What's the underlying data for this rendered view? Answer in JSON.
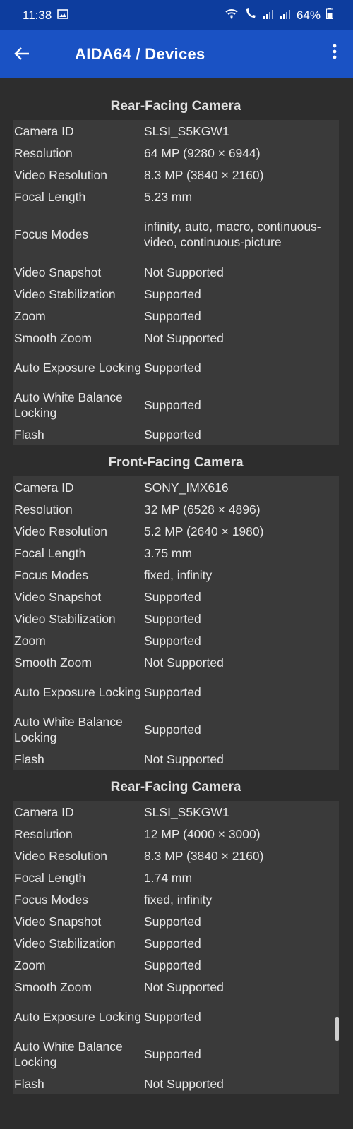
{
  "status": {
    "time": "11:38",
    "battery": "64%"
  },
  "appbar": {
    "title": "AIDA64  /  Devices"
  },
  "sections": [
    {
      "title": "Rear-Facing Camera",
      "rows": [
        {
          "label": "Camera ID",
          "value": "SLSI_S5KGW1"
        },
        {
          "label": "Resolution",
          "value": "64 MP (9280 × 6944)"
        },
        {
          "label": "Video Resolution",
          "value": "8.3 MP (3840 × 2160)"
        },
        {
          "label": "Focal Length",
          "value": "5.23 mm"
        },
        {
          "label": "Focus Modes",
          "value": "infinity, auto, macro, continuous-video, continuous-picture"
        },
        {
          "label": "Video Snapshot",
          "value": "Not Supported"
        },
        {
          "label": "Video Stabilization",
          "value": "Supported"
        },
        {
          "label": "Zoom",
          "value": "Supported"
        },
        {
          "label": "Smooth Zoom",
          "value": "Not Supported"
        },
        {
          "label": "Auto Exposure Locking",
          "value": "Supported"
        },
        {
          "label": "Auto White Balance Locking",
          "value": "Supported"
        },
        {
          "label": "Flash",
          "value": "Supported"
        }
      ]
    },
    {
      "title": "Front-Facing Camera",
      "rows": [
        {
          "label": "Camera ID",
          "value": "SONY_IMX616"
        },
        {
          "label": "Resolution",
          "value": "32 MP (6528 × 4896)"
        },
        {
          "label": "Video Resolution",
          "value": "5.2 MP (2640 × 1980)"
        },
        {
          "label": "Focal Length",
          "value": "3.75 mm"
        },
        {
          "label": "Focus Modes",
          "value": "fixed, infinity"
        },
        {
          "label": "Video Snapshot",
          "value": "Supported"
        },
        {
          "label": "Video Stabilization",
          "value": "Supported"
        },
        {
          "label": "Zoom",
          "value": "Supported"
        },
        {
          "label": "Smooth Zoom",
          "value": "Not Supported"
        },
        {
          "label": "Auto Exposure Locking",
          "value": "Supported"
        },
        {
          "label": "Auto White Balance Locking",
          "value": "Supported"
        },
        {
          "label": "Flash",
          "value": "Not Supported"
        }
      ]
    },
    {
      "title": "Rear-Facing Camera",
      "rows": [
        {
          "label": "Camera ID",
          "value": "SLSI_S5KGW1"
        },
        {
          "label": "Resolution",
          "value": "12 MP (4000 × 3000)"
        },
        {
          "label": "Video Resolution",
          "value": "8.3 MP (3840 × 2160)"
        },
        {
          "label": "Focal Length",
          "value": "1.74 mm"
        },
        {
          "label": "Focus Modes",
          "value": "fixed, infinity"
        },
        {
          "label": "Video Snapshot",
          "value": "Supported"
        },
        {
          "label": "Video Stabilization",
          "value": "Supported"
        },
        {
          "label": "Zoom",
          "value": "Supported"
        },
        {
          "label": "Smooth Zoom",
          "value": "Not Supported"
        },
        {
          "label": "Auto Exposure Locking",
          "value": "Supported"
        },
        {
          "label": "Auto White Balance Locking",
          "value": "Supported"
        },
        {
          "label": "Flash",
          "value": "Not Supported"
        }
      ]
    }
  ]
}
